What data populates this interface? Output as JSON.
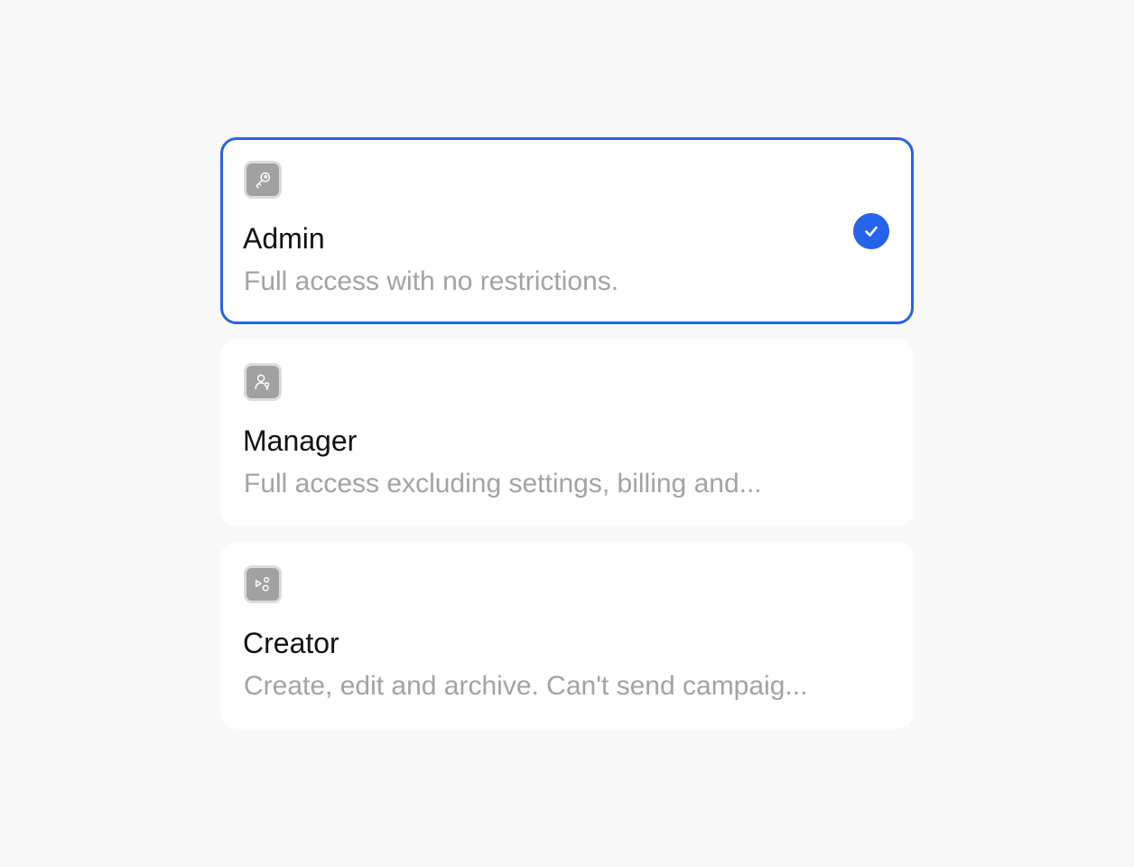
{
  "roles": [
    {
      "id": "admin",
      "icon": "key-icon",
      "title": "Admin",
      "description": "Full access with no restrictions.",
      "selected": true
    },
    {
      "id": "manager",
      "icon": "user-key-icon",
      "title": "Manager",
      "description": "Full access excluding settings, billing and...",
      "selected": false
    },
    {
      "id": "creator",
      "icon": "shapes-icon",
      "title": "Creator",
      "description": "Create, edit and archive. Can't send campaig...",
      "selected": false
    }
  ],
  "colors": {
    "accent": "#2563eb",
    "background": "#f9f9f9",
    "card": "#ffffff",
    "icon_tile": "#a1a1a1",
    "title_text": "#111111",
    "description_text": "#a3a3a3"
  }
}
